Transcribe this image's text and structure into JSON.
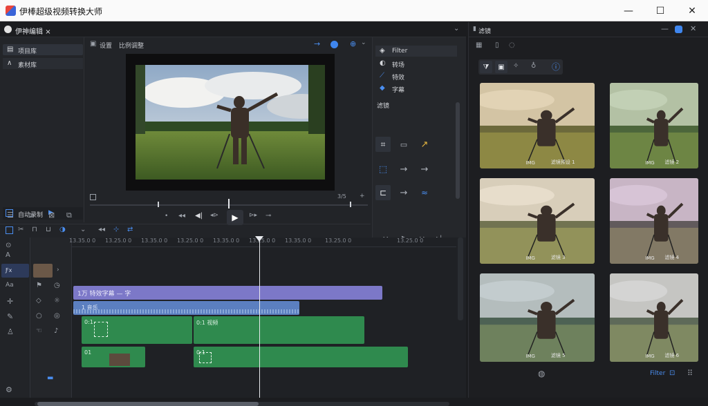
{
  "window": {
    "title": "伊棒超级视频转换大师",
    "minimize": "—",
    "maximize": "☐",
    "close": "✕"
  },
  "project": {
    "tab_label": "伊神编辑",
    "tab_close": "×"
  },
  "media_nav": {
    "items": [
      {
        "label": "项目库"
      },
      {
        "label": "素材库"
      }
    ],
    "footer_label": "自动录制"
  },
  "preview": {
    "toolbar_items": [
      "设置",
      "比例调整"
    ],
    "timecode": "3/5"
  },
  "effects": {
    "items": [
      {
        "label": "Filter"
      },
      {
        "label": "转场"
      },
      {
        "label": "特效"
      },
      {
        "label": "字幕"
      }
    ],
    "section_title": "滤镜"
  },
  "timeline": {
    "ruler_ticks": [
      "13.35.0 0",
      "13.25.0 0",
      "13.35.0 0",
      "13.25.0 0",
      "13.35.0 0",
      "13.25.0 0",
      "13.35.0 0",
      "13.25.0 0",
      "13.25.0 0"
    ],
    "title_clip": "1万 特效字幕 — 字",
    "audio_clip": "1 音乐",
    "video_clip_a": "0:1",
    "video_clip_b": "0:1 视频",
    "video_clip_c": "01",
    "video_clip_d": "0:1"
  },
  "presets": {
    "panel_title": "滤镜",
    "thumbnails": [
      {
        "label_a": "IMG",
        "label_b": "滤镜预设 1",
        "tint": "#c9a35a"
      },
      {
        "label_a": "IMG",
        "label_b": "滤镜 2",
        "tint": "#6c9a58"
      },
      {
        "label_a": "IMG",
        "label_b": "滤镜 3",
        "tint": "#d8c098"
      },
      {
        "label_a": "IMG",
        "label_b": "滤镜 4",
        "tint": "#a878b8"
      },
      {
        "label_a": "IMG",
        "label_b": "滤镜 5",
        "tint": "#6f8fa0"
      },
      {
        "label_a": "IMG",
        "label_b": "滤镜 6",
        "tint": "#a0a7ae"
      }
    ],
    "footer_label": "Filter"
  },
  "colors": {
    "accent": "#4a8ef0",
    "green_clip": "#2f8a4e",
    "purple_clip": "#7c78c8",
    "blue_clip": "#5b7fc0"
  }
}
